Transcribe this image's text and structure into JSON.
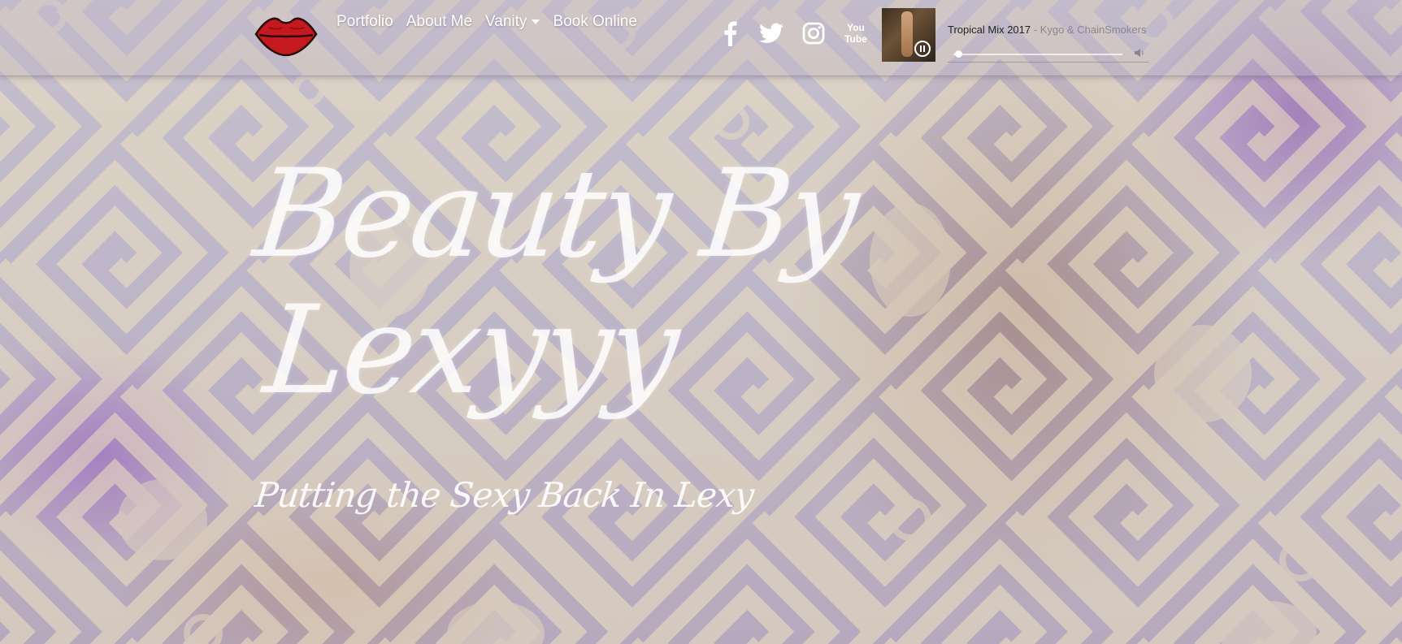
{
  "nav": {
    "items": [
      {
        "label": "Portfolio"
      },
      {
        "label": "About Me"
      },
      {
        "label": "Vanity",
        "has_dropdown": true
      },
      {
        "label": "Book Online"
      }
    ]
  },
  "social": [
    {
      "icon": "facebook-icon"
    },
    {
      "icon": "twitter-icon"
    },
    {
      "icon": "instagram-icon"
    },
    {
      "icon": "youtube-icon",
      "text_top": "You",
      "text_bottom": "Tube"
    }
  ],
  "player": {
    "track_title": "Tropical Mix 2017",
    "artist": "- Kygo & ChainSmokers",
    "state": "playing",
    "progress": 0.02
  },
  "hero": {
    "title_line1": "Beauty By",
    "title_line2": "Lexyyy",
    "subtitle": "Putting the Sexy Back In Lexy"
  },
  "colors": {
    "lips": "#c4191e",
    "nav_text": "#ffffff",
    "accent_gold": "#e6d9b4"
  }
}
